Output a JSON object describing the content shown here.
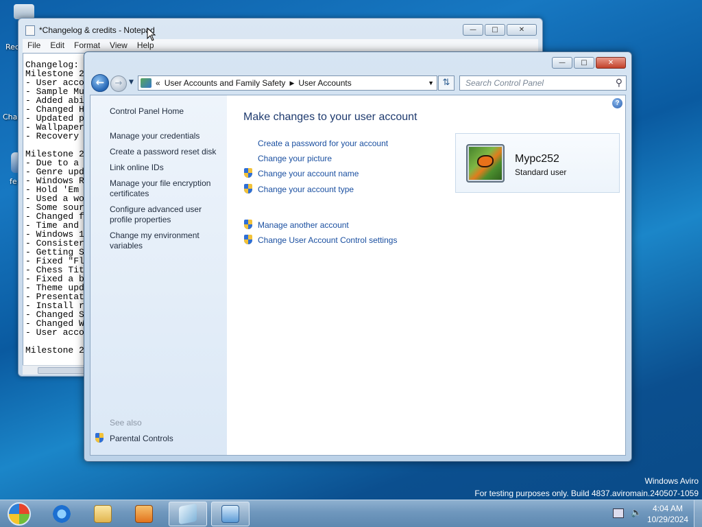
{
  "desktop": {
    "icons": [
      {
        "label": "Rec"
      },
      {
        "label": "Cha"
      },
      {
        "label": "fe"
      }
    ],
    "watermark_line1": "Windows Aviro",
    "watermark_line2": "For testing purposes only. Build 4837.aviromain.240507-1059"
  },
  "notepad": {
    "title": "*Changelog & credits - Notepad",
    "menu": [
      "File",
      "Edit",
      "Format",
      "View",
      "Help"
    ],
    "text": "Changelog:\nMilestone 2\n- User acco\n- Sample Mu\n- Added abi\n- Changed H\n- Updated p\n- Wallpaper\n- Recovery \n\nMilestone 2\n- Due to a \n- Genre upd\n- Windows R\n- Hold 'Em \n- Used a wo\n- Some sour\n- Changed f\n- Time and \n- Windows 1\n- Consister\n- Getting S\n- Fixed \"Fl\n- Chess Tit\n- Fixed a b\n- Theme upd\n- Presentat\n- Install r\n- Changed S\n- Changed W\n- User acco\n\nMilestone 2"
  },
  "control_panel": {
    "breadcrumb": [
      "User Accounts and Family Safety",
      "User Accounts"
    ],
    "search_placeholder": "Search Control Panel",
    "left_links": [
      "Control Panel Home",
      "Manage your credentials",
      "Create a password reset disk",
      "Link online IDs",
      "Manage your file encryption certificates",
      "Configure advanced user profile properties",
      "Change my environment variables"
    ],
    "see_also_label": "See also",
    "see_also_links": [
      "Parental Controls"
    ],
    "heading": "Make changes to your user account",
    "actions": [
      "Create a password for your account",
      "Change your picture",
      "Change your account name",
      "Change your account type"
    ],
    "other_actions": [
      "Manage another account",
      "Change User Account Control settings"
    ],
    "user": {
      "name": "Mypc252",
      "type": "Standard user"
    }
  },
  "taskbar": {
    "clock_time": "4:04 AM",
    "clock_date": "10/29/2024",
    "pinned": [
      "start-button",
      "internet-explorer-icon",
      "file-explorer-icon",
      "media-player-icon",
      "notepad-icon",
      "control-panel-icon"
    ]
  }
}
